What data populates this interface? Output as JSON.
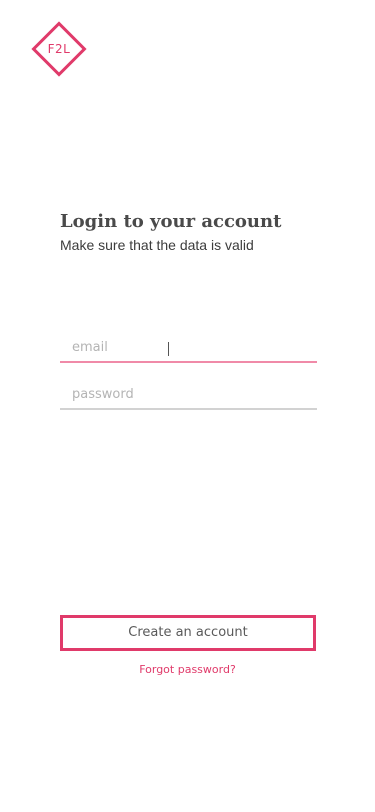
{
  "brand": {
    "logo_text": "F2L",
    "accent_color": "#e03a6a",
    "logo_icon": "diamond-logo-icon"
  },
  "header": {
    "title": "Login to your account",
    "subtitle": "Make sure that the data is valid"
  },
  "form": {
    "email": {
      "value": "",
      "placeholder": "email"
    },
    "password": {
      "value": "",
      "placeholder": "password"
    }
  },
  "actions": {
    "create_account_label": "Create an account",
    "forgot_password_label": "Forgot password?"
  }
}
